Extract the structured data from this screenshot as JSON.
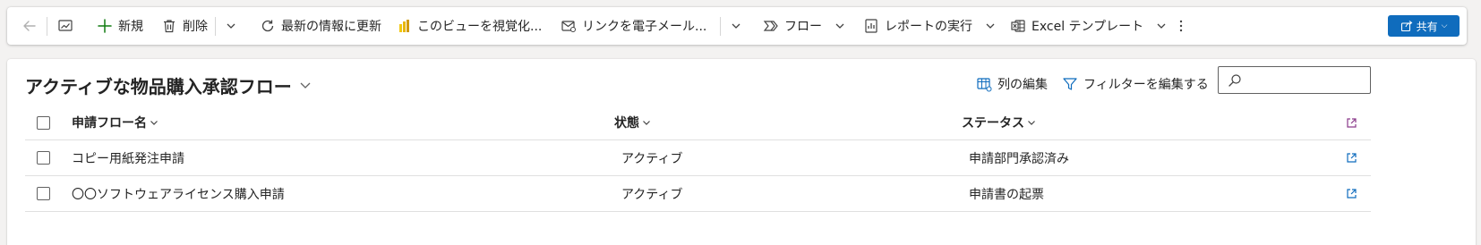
{
  "toolbar": {
    "new_label": "新規",
    "delete_label": "削除",
    "refresh_label": "最新の情報に更新",
    "visualize_label": "このビューを視覚化...",
    "email_link_label": "リンクを電子メール...",
    "flow_label": "フロー",
    "run_report_label": "レポートの実行",
    "excel_template_label": "Excel テンプレート",
    "share_label": "共有"
  },
  "view": {
    "title": "アクティブな物品購入承認フロー",
    "edit_columns_label": "列の編集",
    "edit_filters_label": "フィルターを編集する",
    "search_placeholder": ""
  },
  "grid": {
    "columns": [
      "申請フロー名",
      "状態",
      "ステータス"
    ],
    "rows": [
      [
        "コピー用紙発注申請",
        "アクティブ",
        "申請部門承認済み"
      ],
      [
        "〇〇ソフトウェアライセンス購入申請",
        "アクティブ",
        "申請書の起票"
      ]
    ]
  },
  "colors": {
    "accent": "#0f6cbd",
    "background": "#f3f2f1",
    "panel": "#ffffff",
    "powerbi_yellow": "#f2c811"
  },
  "icons": {
    "back": "arrow-left-icon",
    "chart": "chart-icon",
    "new": "plus-icon",
    "delete": "trash-icon",
    "refresh": "refresh-icon",
    "visualize": "powerbi-icon",
    "email": "mail-link-icon",
    "flow": "flow-icon",
    "report": "report-icon",
    "excel": "excel-template-icon",
    "more": "more-vertical-icon",
    "share": "share-icon",
    "columns": "edit-columns-icon",
    "filter": "filter-icon",
    "search": "search-icon",
    "open": "open-record-icon"
  }
}
